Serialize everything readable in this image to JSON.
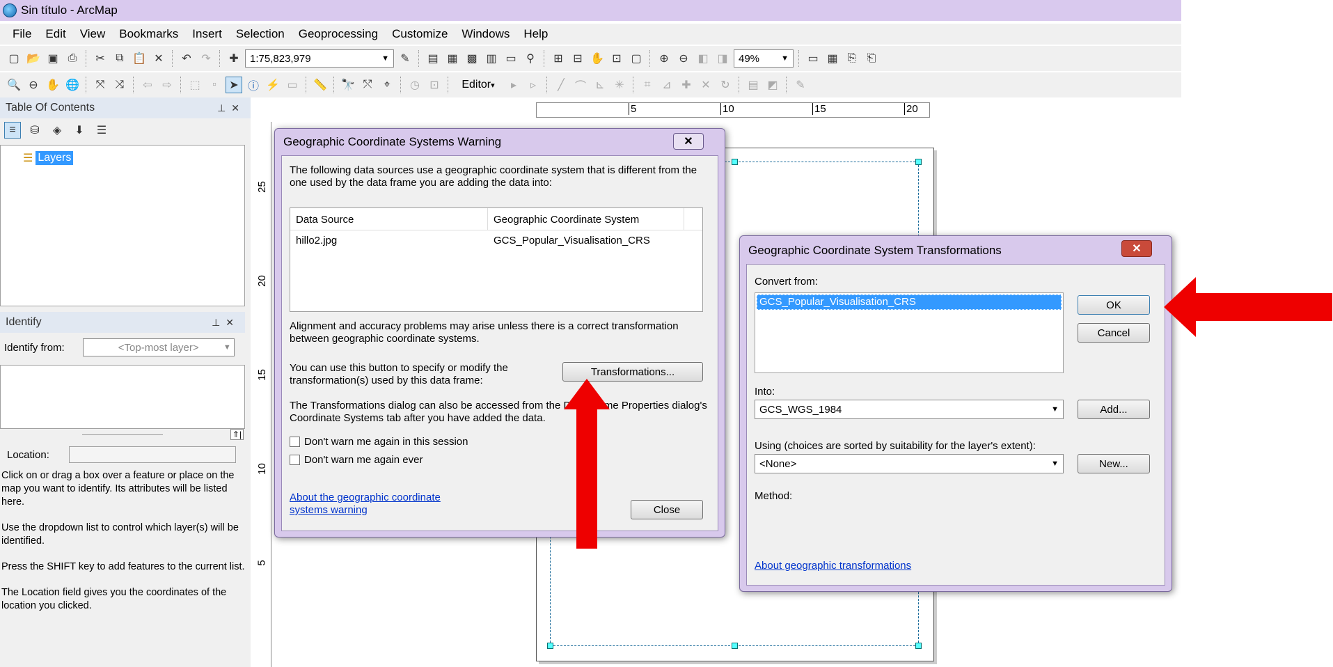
{
  "window": {
    "title": "Sin título - ArcMap"
  },
  "menu": [
    "File",
    "Edit",
    "View",
    "Bookmarks",
    "Insert",
    "Selection",
    "Geoprocessing",
    "Customize",
    "Windows",
    "Help"
  ],
  "toolbar": {
    "scale": "1:75,823,979",
    "zoom": "49%",
    "editor": "Editor"
  },
  "toc": {
    "title": "Table Of Contents",
    "layers_label": "Layers"
  },
  "identify": {
    "title": "Identify",
    "from_label": "Identify from:",
    "from_value": "<Top-most layer>",
    "location_label": "Location:",
    "help": [
      "Click on or drag a box over a feature or place on the map you want to identify. Its attributes will be listed here.",
      "Use the dropdown list to control which layer(s) will be identified.",
      "Press the SHIFT key to add features to the current list.",
      "The Location field gives you the coordinates of the location you clicked."
    ]
  },
  "rulers": {
    "h": [
      "5",
      "10",
      "15",
      "20"
    ],
    "v": [
      "25",
      "20",
      "15",
      "10",
      "5"
    ]
  },
  "warning": {
    "title": "Geographic Coordinate Systems Warning",
    "intro": "The following data sources use a geographic coordinate system that is different from the one used by the data frame you are adding the data into:",
    "col1": "Data Source",
    "col2": "Geographic Coordinate System",
    "rows": [
      {
        "source": "hillo2.jpg",
        "gcs": "GCS_Popular_Visualisation_CRS"
      }
    ],
    "align_text": "Alignment and accuracy problems may arise unless there is a correct transformation between geographic coordinate systems.",
    "button_text": "You can use this button to specify or modify the transformation(s) used by this data frame:",
    "transformations_btn": "Transformations...",
    "access_text": "The Transformations dialog can also be accessed from the Data Frame Properties dialog's Coordinate Systems tab after you have added the data.",
    "chk1": "Don't warn me again in this session",
    "chk2": "Don't warn me again ever",
    "link": "About the geographic coordinate systems warning",
    "close": "Close"
  },
  "transform": {
    "title": "Geographic Coordinate System Transformations",
    "convert_label": "Convert from:",
    "convert_item": "GCS_Popular_Visualisation_CRS",
    "ok": "OK",
    "cancel": "Cancel",
    "into_label": "Into:",
    "into_value": "GCS_WGS_1984",
    "add": "Add...",
    "using_label": "Using (choices are sorted by suitability for the layer's extent):",
    "using_value": "<None>",
    "new": "New...",
    "method_label": "Method:",
    "link": "About geographic transformations"
  },
  "colors": {
    "arrow": "#ee0000",
    "title_bg": "#d9c9ee",
    "selected": "#3399ff"
  }
}
